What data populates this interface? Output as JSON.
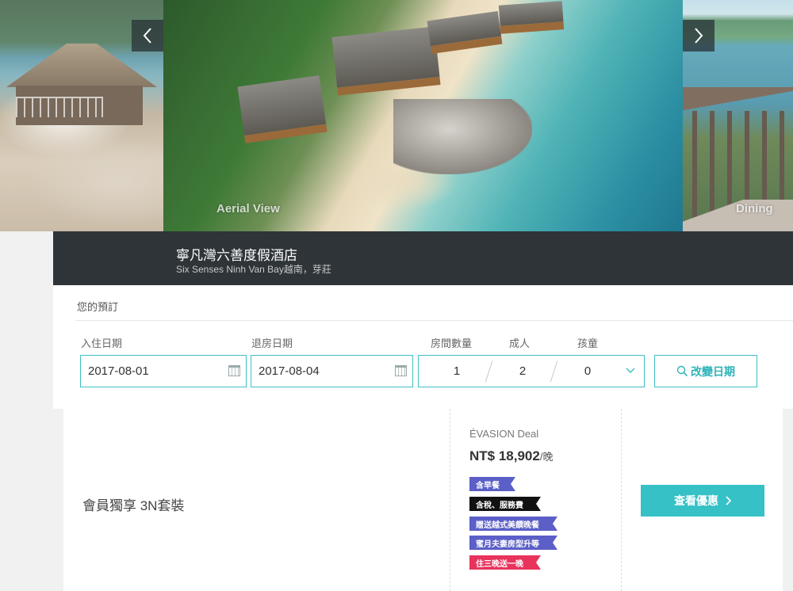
{
  "carousel": {
    "captions": {
      "left": "",
      "main": "Aerial View",
      "right": "Dining"
    },
    "prev_icon": "chevron-left-icon",
    "next_icon": "chevron-right-icon"
  },
  "hotel": {
    "name": "寧凡灣六善度假酒店",
    "subtitle": "Six Senses Ninh Van Bay越南，芽莊"
  },
  "booking": {
    "title": "您的預訂",
    "checkin_label": "入住日期",
    "checkin_value": "2017-08-01",
    "checkout_label": "退房日期",
    "checkout_value": "2017-08-04",
    "rooms_label": "房間數量",
    "rooms_value": "1",
    "adults_label": "成人",
    "adults_value": "2",
    "children_label": "孩童",
    "children_value": "0",
    "change_label": "改變日期",
    "accent_color": "#3fbfc2"
  },
  "room": {
    "name": "會員獨享 3N套裝",
    "deal_label": "ÉVASION Deal",
    "price": "NT$ 18,902",
    "price_unit": "/晚",
    "tags": [
      {
        "label": "含早餐",
        "color": "#5b5fc7"
      },
      {
        "label": "含稅、服務費",
        "color": "#111111"
      },
      {
        "label": "贈送越式美饌晚餐",
        "color": "#5b5fc7"
      },
      {
        "label": "蜜月夫妻房型升等",
        "color": "#5b5fc7"
      },
      {
        "label": "住三晚送一晚",
        "color": "#e8335c"
      }
    ],
    "cta_label": "查看優惠",
    "cta_color": "#35c1c6"
  }
}
